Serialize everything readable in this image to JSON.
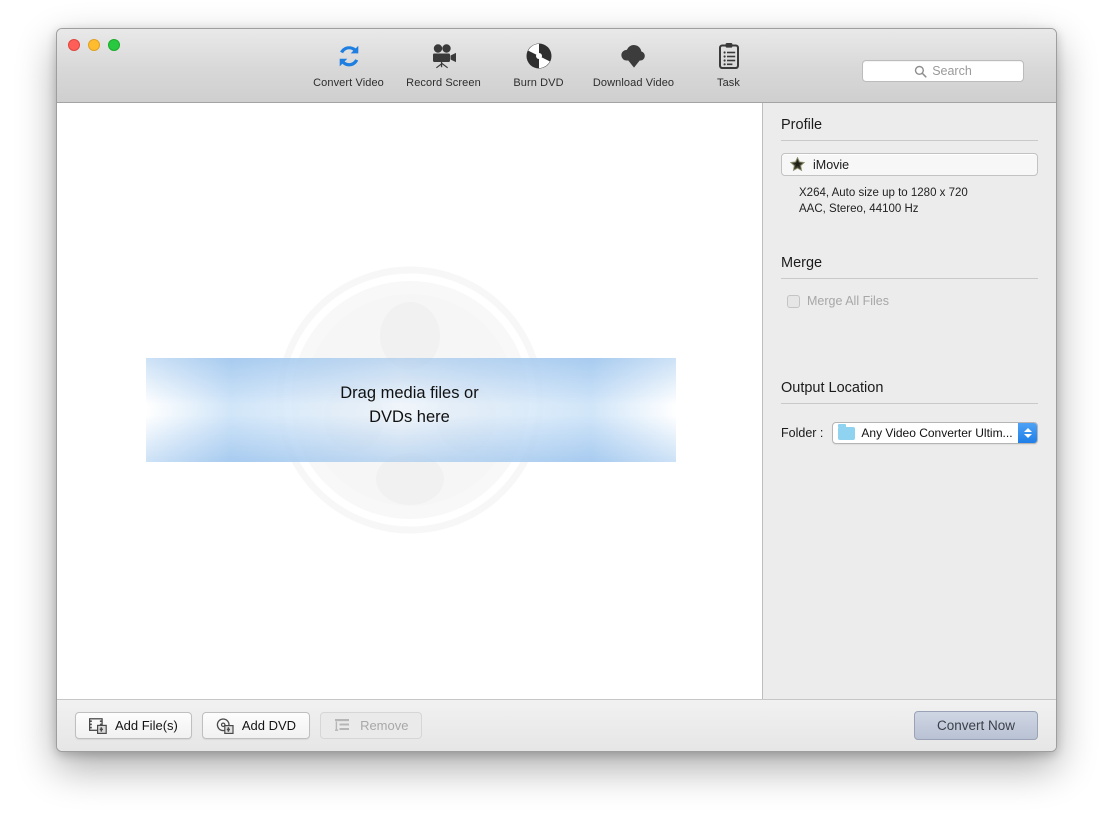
{
  "window": {
    "traffic_lights": [
      "close",
      "minimize",
      "maximize"
    ]
  },
  "toolbar": {
    "items": [
      {
        "label": "Convert Video",
        "icon": "convert-video-icon"
      },
      {
        "label": "Record Screen",
        "icon": "record-screen-icon"
      },
      {
        "label": "Burn DVD",
        "icon": "burn-dvd-icon"
      },
      {
        "label": "Download Video",
        "icon": "download-video-icon"
      },
      {
        "label": "Task",
        "icon": "task-icon"
      }
    ],
    "search": {
      "placeholder": "Search",
      "value": "",
      "icon": "search-icon"
    }
  },
  "drop_area": {
    "line1": "Drag media files or",
    "line2": "DVDs here",
    "watermark": "film-reel-watermark"
  },
  "panel": {
    "profile": {
      "title": "Profile",
      "selected": "iMovie",
      "icon": "imovie-star-icon",
      "description_line1": "X264, Auto size up to 1280 x 720",
      "description_line2": "AAC, Stereo, 44100 Hz"
    },
    "merge": {
      "title": "Merge",
      "checkbox_label": "Merge All Files",
      "checked": false,
      "disabled": true
    },
    "output": {
      "title": "Output Location",
      "folder_label": "Folder :",
      "folder_value": "Any Video Converter Ultim...",
      "folder_icon": "folder-icon"
    }
  },
  "bottom_bar": {
    "add_files": {
      "label": "Add File(s)",
      "icon": "add-files-icon",
      "disabled": false
    },
    "add_dvd": {
      "label": "Add DVD",
      "icon": "add-dvd-icon",
      "disabled": false
    },
    "remove": {
      "label": "Remove",
      "icon": "remove-icon",
      "disabled": true
    },
    "convert": {
      "label": "Convert Now"
    }
  },
  "colors": {
    "accent_blue": "#1f7fe8",
    "convert_icon_blue": "#1e7fe0",
    "folder_blue": "#8fd3f0",
    "panel_bg": "#ececec",
    "toolbar_bg": "#d8d8d8",
    "convert_button": "#c4ccdb"
  }
}
